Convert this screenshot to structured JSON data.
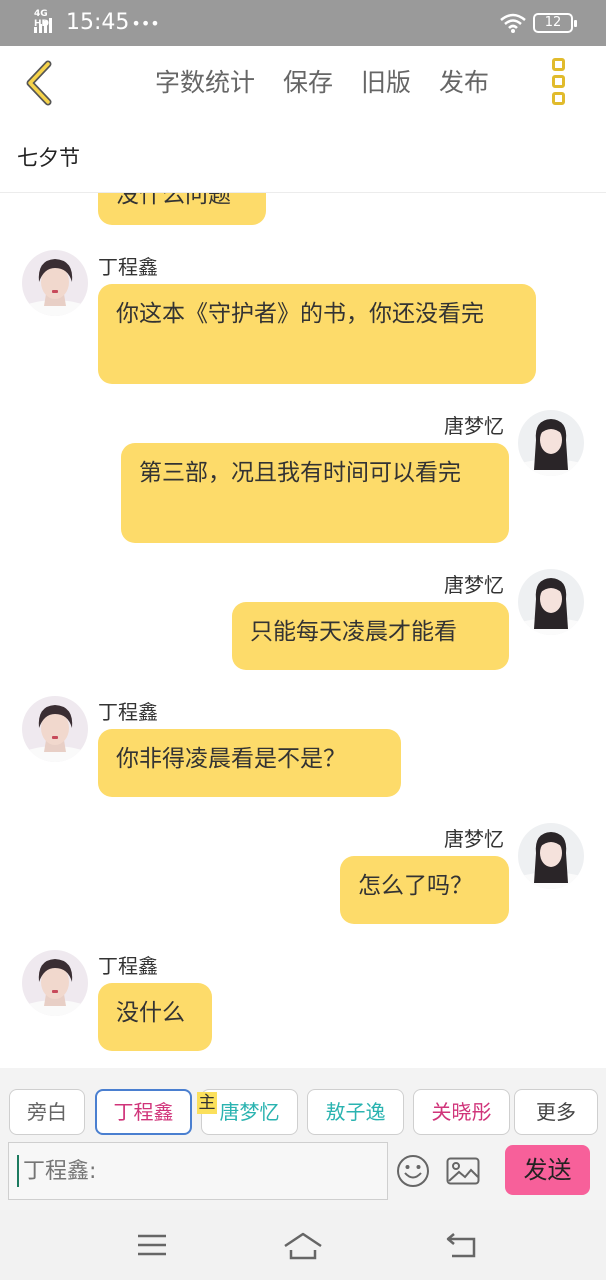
{
  "status_bar": {
    "network": "4G HD",
    "time": "15:45",
    "extra": "•••",
    "battery": "12"
  },
  "toolbar": {
    "back_icon": "chevron-left-icon",
    "items": [
      "字数统计",
      "保存",
      "旧版",
      "发布"
    ],
    "more_icon": "vertical-more-icon"
  },
  "chapter": {
    "title": "七夕节"
  },
  "messages": [
    {
      "speaker": "",
      "side": "left",
      "text": "没什么问题"
    },
    {
      "speaker": "丁程鑫",
      "side": "left",
      "text": "你这本《守护者》的书，你还没看完"
    },
    {
      "speaker": "唐梦忆",
      "side": "right",
      "text": "第三部，况且我有时间可以看完"
    },
    {
      "speaker": "唐梦忆",
      "side": "right",
      "text": "只能每天凌晨才能看"
    },
    {
      "speaker": "丁程鑫",
      "side": "left",
      "text": "你非得凌晨看是不是？"
    },
    {
      "speaker": "唐梦忆",
      "side": "right",
      "text": "怎么了吗？"
    },
    {
      "speaker": "丁程鑫",
      "side": "left",
      "text": "没什么"
    }
  ],
  "roles": {
    "items": [
      "旁白",
      "丁程鑫",
      "唐梦忆",
      "敖子逸",
      "关晓彤",
      "更多"
    ],
    "colors": [
      "#666666",
      "#d0347a",
      "#2ab3b0",
      "#2ab3b0",
      "#d0347a",
      "#444444"
    ],
    "main_badge": "主"
  },
  "composer": {
    "placeholder": "丁程鑫:",
    "emoji_icon": "smiley-icon",
    "image_icon": "image-icon",
    "send_label": "发送"
  },
  "navbar": {
    "menu_icon": "menu-icon",
    "home_icon": "home-icon",
    "back_icon": "back-arrow-icon"
  },
  "colors": {
    "bubble": "#fddb6a",
    "accent": "#e1bb2c",
    "send": "#f7609a",
    "status_bar": "#9a9a9a"
  }
}
